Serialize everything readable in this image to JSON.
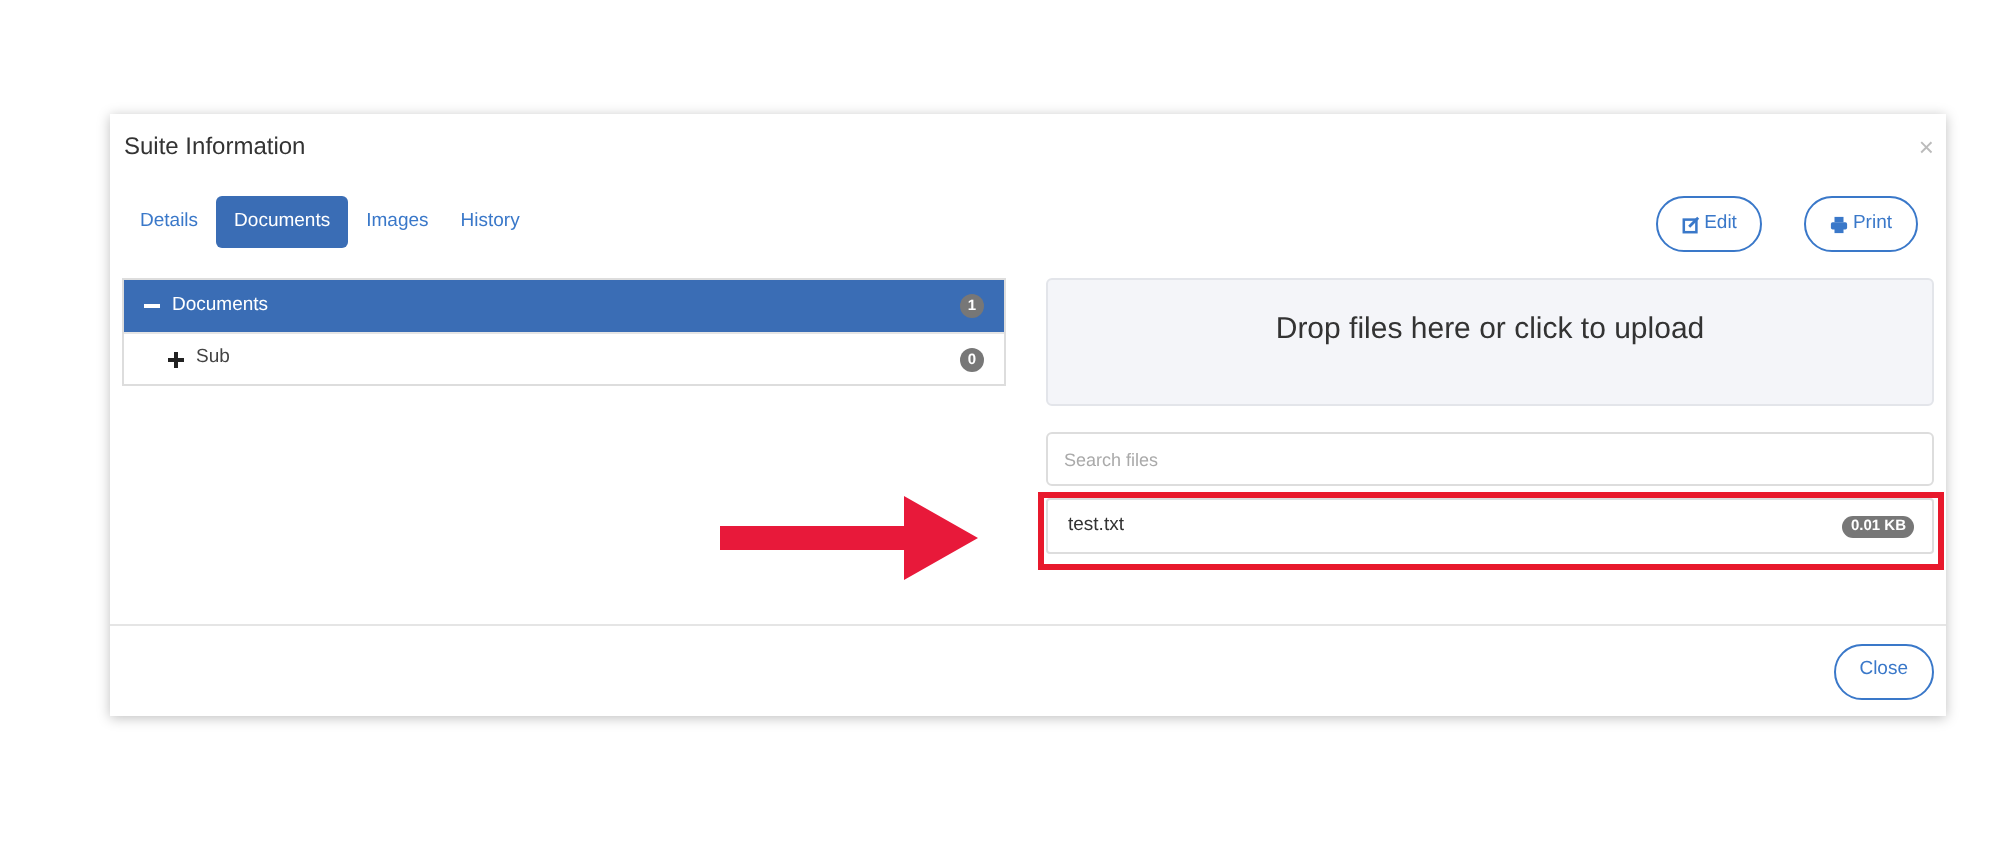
{
  "dialog": {
    "title": "Suite Information",
    "close": "×"
  },
  "tabs": [
    {
      "label": "Details",
      "selected": false
    },
    {
      "label": "Documents",
      "selected": true
    },
    {
      "label": "Images",
      "selected": false
    },
    {
      "label": "History",
      "selected": false
    }
  ],
  "actions": [
    {
      "kind": "edit",
      "label": "Edit"
    },
    {
      "kind": "print",
      "label": "Print"
    }
  ],
  "tree": [
    {
      "label": "Documents",
      "count": "1",
      "expanded": true,
      "selected": true,
      "children": [
        {
          "label": "Sub",
          "count": "0",
          "expanded": false,
          "selected": false
        }
      ]
    }
  ],
  "dropzone": {
    "text": "Drop files here or click to upload"
  },
  "search": {
    "placeholder": "Search files"
  },
  "files": [
    {
      "name": "test.txt",
      "size": "0.01 KB"
    }
  ],
  "footer": {
    "buttons": [
      "Close"
    ]
  }
}
